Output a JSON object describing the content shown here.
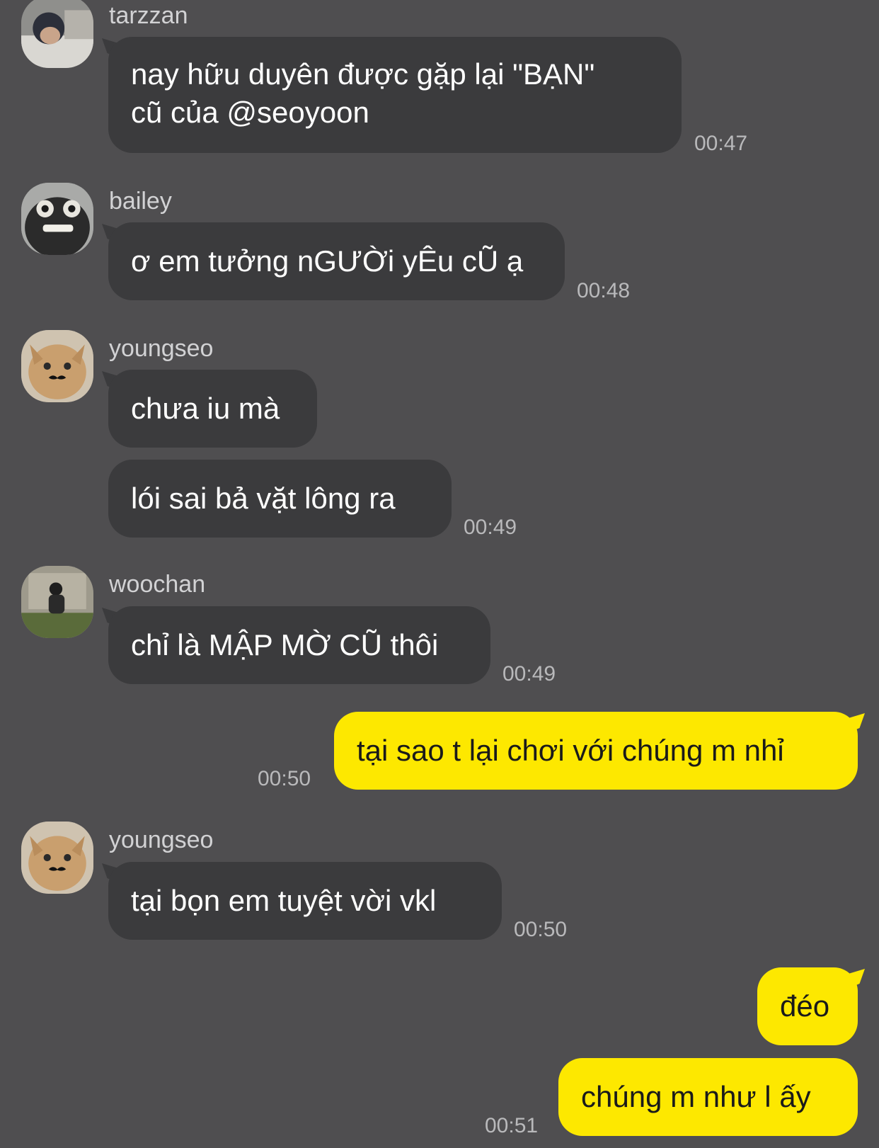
{
  "messages": [
    {
      "sender": "tarzzan",
      "lines": [
        "nay hữu duyên được gặp lại \"BẠN\"",
        "cũ của @seoyoon"
      ],
      "time": "00:47"
    },
    {
      "sender": "bailey",
      "text": "ơ em tưởng nGƯỜi yÊu cŨ ạ",
      "time": "00:48"
    },
    {
      "sender": "youngseo",
      "text": "chưa iu mà"
    },
    {
      "text": "lói sai bả vặt lông ra",
      "time": "00:49"
    },
    {
      "sender": "woochan",
      "text": "chỉ là MẬP MỜ CŨ thôi",
      "time": "00:49"
    },
    {
      "text": "tại sao t lại chơi với chúng m nhỉ",
      "time": "00:50"
    },
    {
      "sender": "youngseo",
      "text": "tại bọn em tuyệt vời vkl",
      "time": "00:50"
    },
    {
      "text": "đéo"
    },
    {
      "text": "chúng m như l ấy",
      "time": "00:51"
    }
  ]
}
